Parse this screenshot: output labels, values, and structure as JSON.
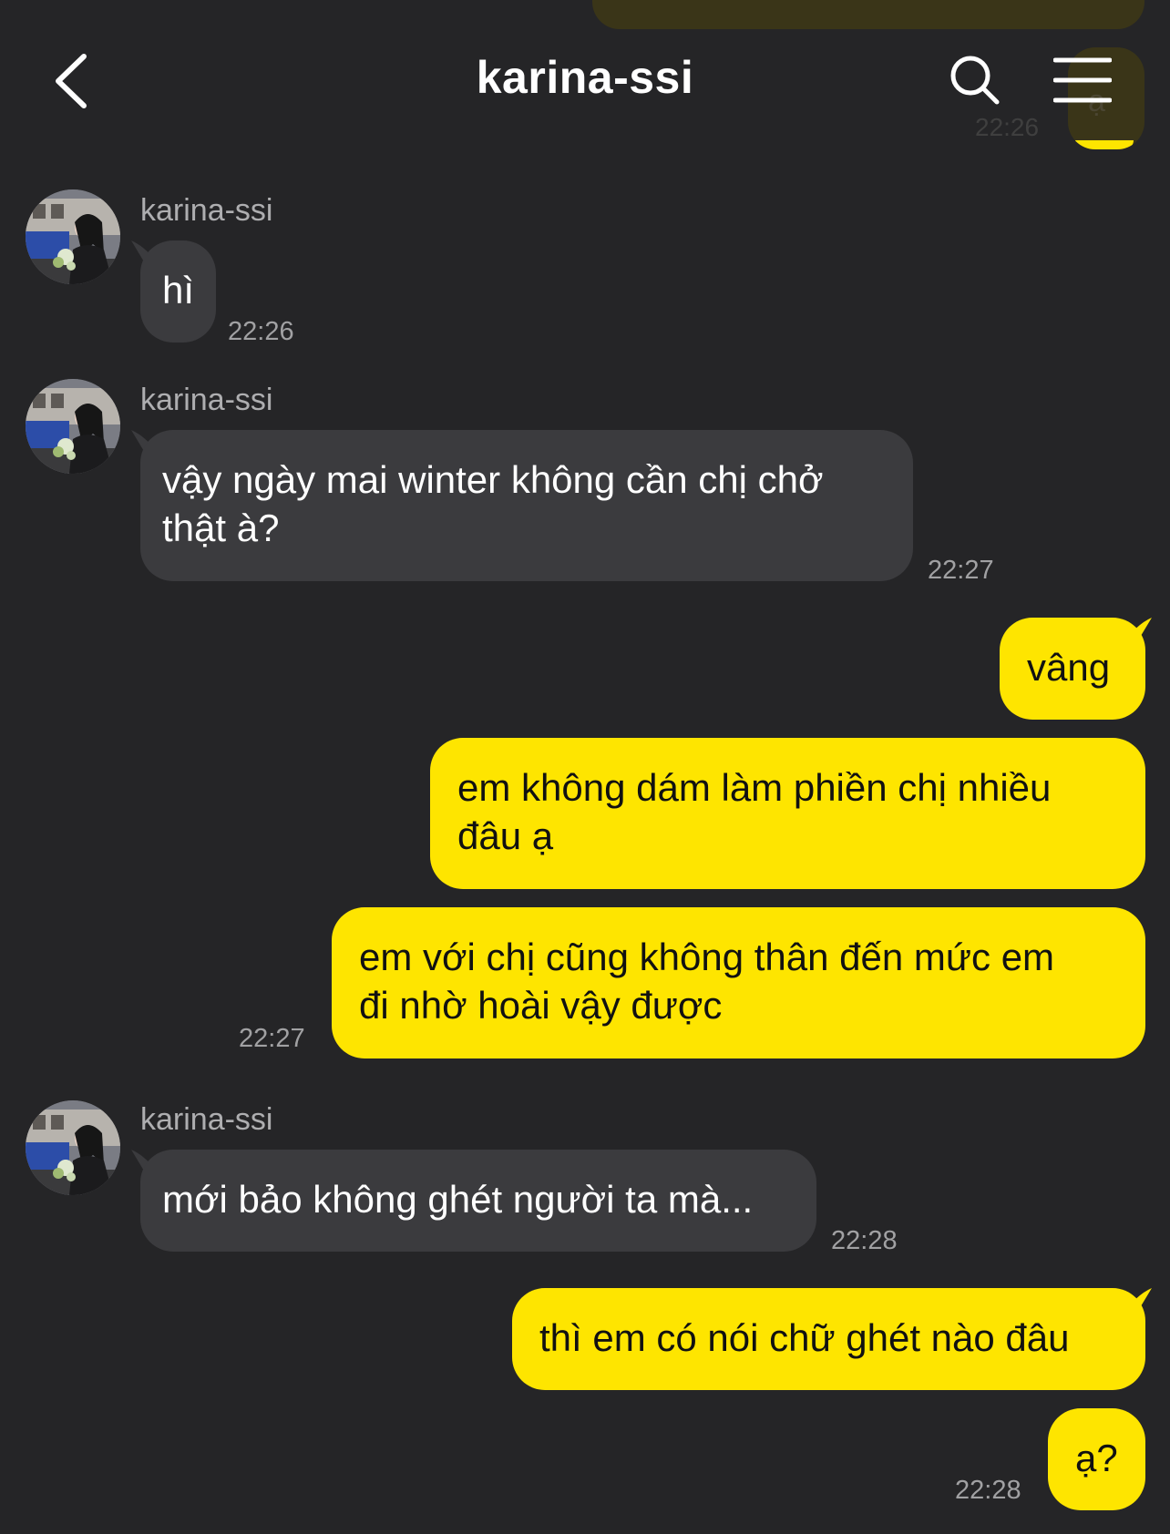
{
  "header": {
    "title": "karina-ssi",
    "back_icon": "chevron-left-icon",
    "search_icon": "search-icon",
    "menu_icon": "hamburger-menu-icon"
  },
  "ghost": {
    "text": "ạ",
    "time": "22:26"
  },
  "colors": {
    "background": "#252527",
    "incoming_bubble": "#3b3b3e",
    "outgoing_bubble": "#fee500",
    "timestamp": "#a1a1a3"
  },
  "messages": [
    {
      "sender": "karina-ssi",
      "text": "hì",
      "time": "22:26"
    },
    {
      "sender": "karina-ssi",
      "line1": "vậy ngày mai winter không cần chị chở",
      "line2": "thật à?",
      "time": "22:27"
    },
    {
      "text": "vâng"
    },
    {
      "line1": "em không dám làm phiền chị nhiều",
      "line2": "đâu ạ"
    },
    {
      "line1": "em với chị cũng không thân đến mức em",
      "line2": "đi nhờ hoài vậy được",
      "time": "22:27"
    },
    {
      "sender": "karina-ssi",
      "text": "mới bảo không ghét người ta mà...",
      "time": "22:28"
    },
    {
      "text": "thì em có nói chữ ghét nào đâu"
    },
    {
      "text": "ạ?",
      "time": "22:28"
    }
  ]
}
